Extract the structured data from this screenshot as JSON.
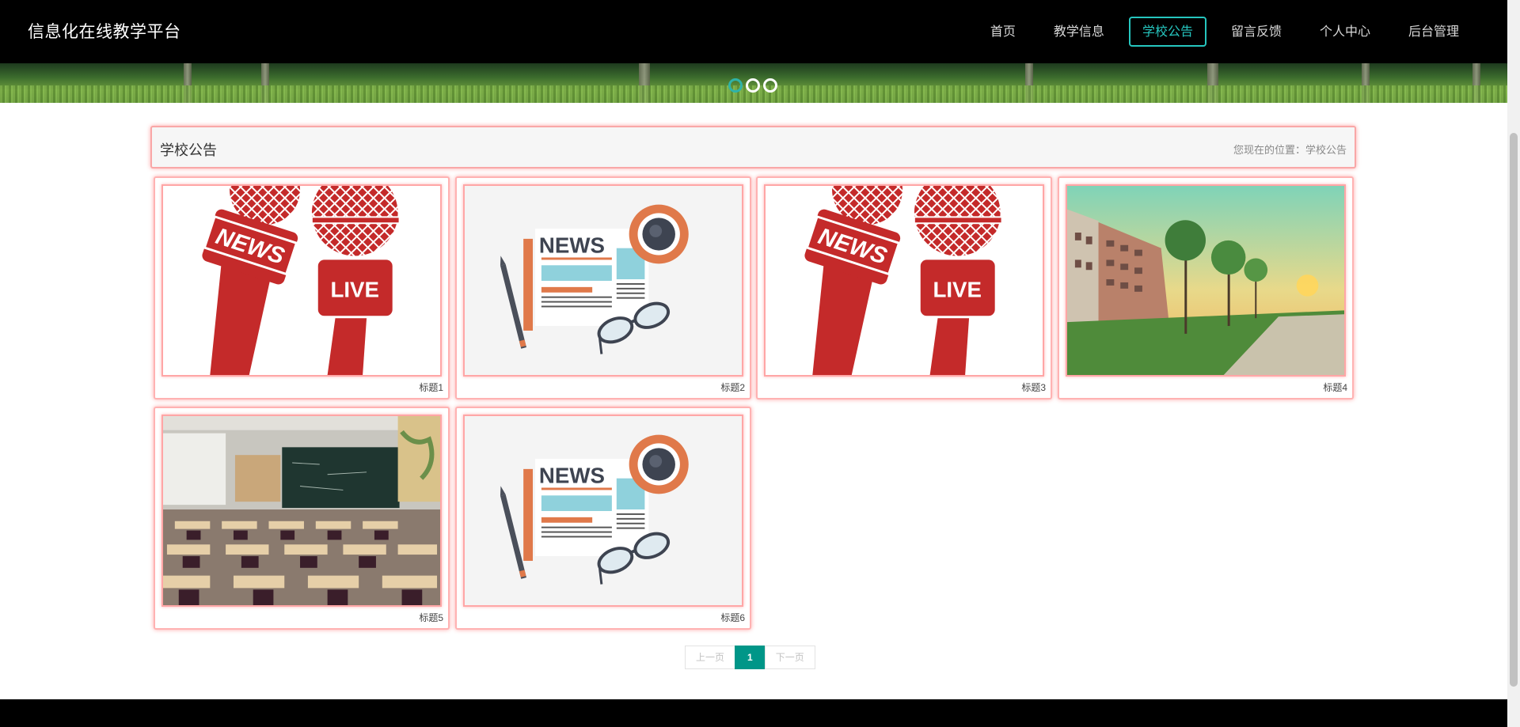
{
  "header": {
    "brand": "信息化在线教学平台",
    "nav": [
      {
        "label": "首页",
        "active": false
      },
      {
        "label": "教学信息",
        "active": false
      },
      {
        "label": "学校公告",
        "active": true
      },
      {
        "label": "留言反馈",
        "active": false
      },
      {
        "label": "个人中心",
        "active": false
      },
      {
        "label": "后台管理",
        "active": false
      }
    ]
  },
  "banner": {
    "slides": 3,
    "active_slide": 1
  },
  "main": {
    "title": "学校公告",
    "breadcrumb": "您现在的位置：学校公告"
  },
  "cards": [
    {
      "caption": "标题1",
      "image": "news-live-microphone"
    },
    {
      "caption": "标题2",
      "image": "newspaper-coffee-glasses"
    },
    {
      "caption": "标题3",
      "image": "news-live-microphone"
    },
    {
      "caption": "标题4",
      "image": "campus-building-sunset"
    },
    {
      "caption": "标题5",
      "image": "classroom-desks"
    },
    {
      "caption": "标题6",
      "image": "newspaper-coffee-glasses"
    }
  ],
  "pagination": {
    "prev": "上一页",
    "current": "1",
    "next": "下一页"
  },
  "colors": {
    "accent": "#26c6bf",
    "pager_active": "#009688",
    "header_bg": "#000000",
    "mic_red": "#c42a2a"
  }
}
